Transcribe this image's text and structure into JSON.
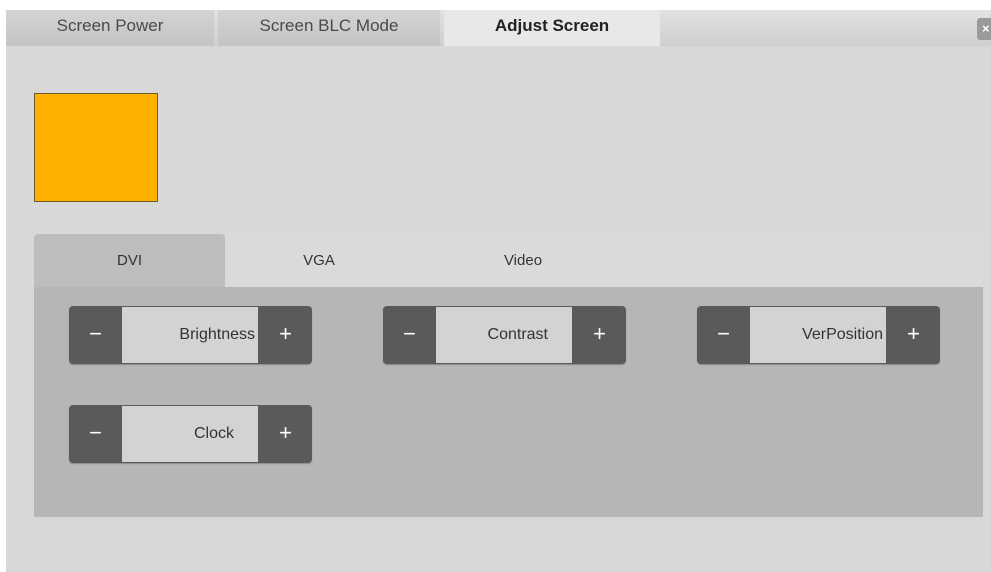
{
  "top_tabs": [
    {
      "label": "Screen Power"
    },
    {
      "label": "Screen BLC Mode"
    },
    {
      "label": "Adjust Screen",
      "active": true
    }
  ],
  "close_icon": "close-icon",
  "swatch": {
    "color": "#ffb000"
  },
  "sub_tabs": [
    {
      "label": "DVI",
      "active": true
    },
    {
      "label": "VGA"
    },
    {
      "label": "Video"
    }
  ],
  "controls": [
    {
      "label": "Brightness",
      "minus": "−",
      "plus": "+"
    },
    {
      "label": "Contrast",
      "minus": "−",
      "plus": "+"
    },
    {
      "label": "VerPosition",
      "minus": "−",
      "plus": "+"
    },
    {
      "label": "Clock",
      "minus": "−",
      "plus": "+"
    }
  ],
  "colors": {
    "stepper_bg": "#5a5a5a",
    "panel_bg": "#b6b6b6",
    "active_subtab": "#bdbdbd"
  }
}
